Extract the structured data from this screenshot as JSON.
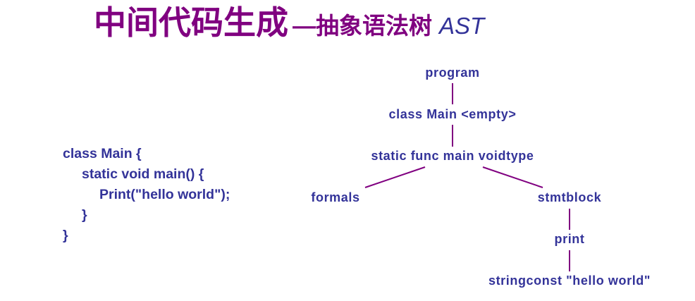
{
  "title": {
    "main": "中间代码生成",
    "sub": "—抽象语法树",
    "ast": "AST"
  },
  "code": {
    "lines": [
      "class Main {",
      "static void main() {",
      "Print(\"hello world\");",
      "}",
      "}"
    ]
  },
  "ast": {
    "nodes": {
      "program": "program",
      "class": "class Main <empty>",
      "func": "static func main voidtype",
      "formals": "formals",
      "stmtblock": "stmtblock",
      "print": "print",
      "stringconst": "stringconst \"hello world\""
    }
  },
  "colors": {
    "title": "#800080",
    "text": "#333399",
    "edges": "#800080"
  }
}
